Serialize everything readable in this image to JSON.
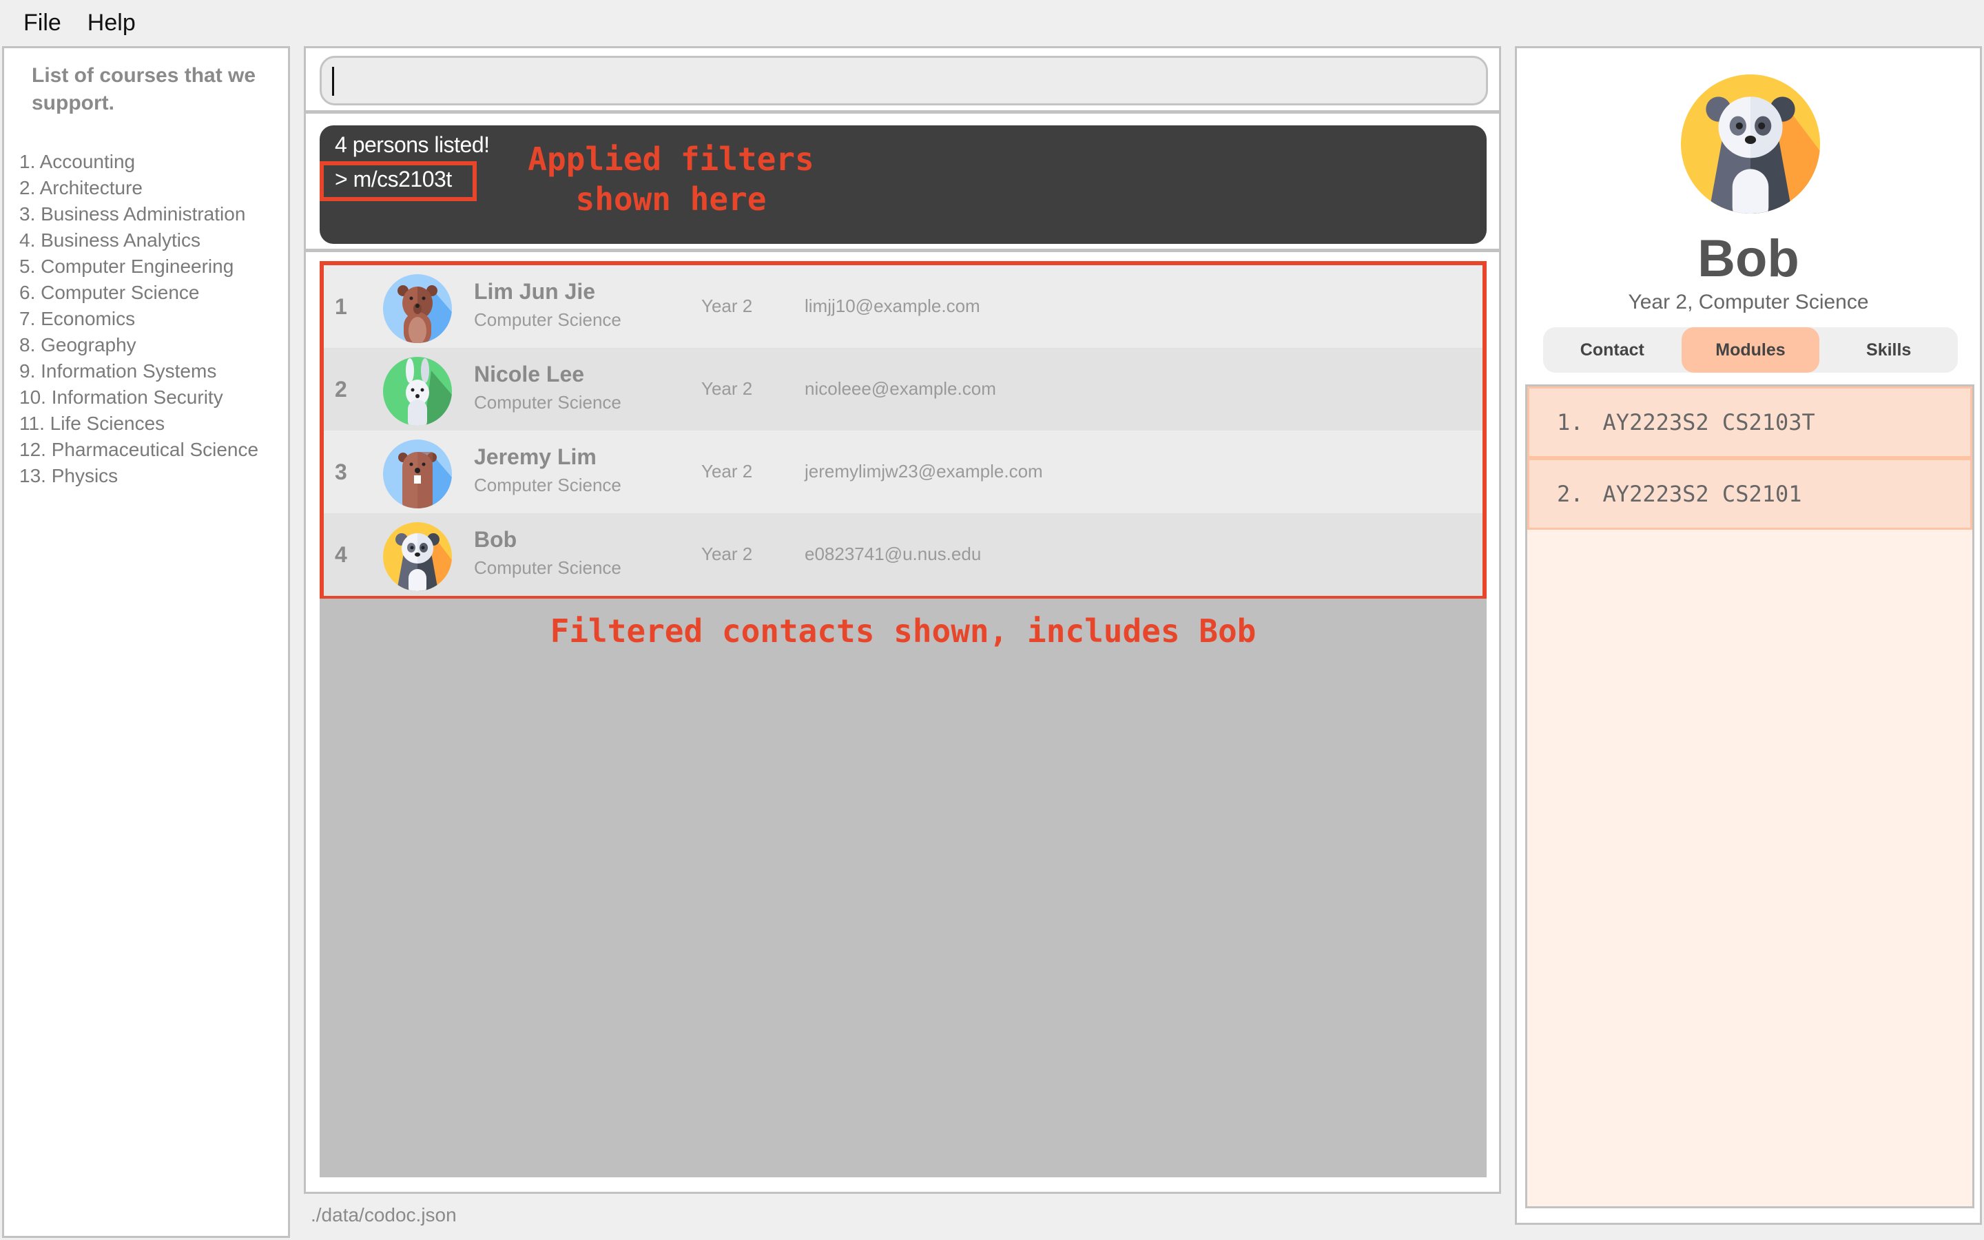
{
  "menu": {
    "items": [
      "File",
      "Help"
    ]
  },
  "sidebar": {
    "title": "List of courses that we support.",
    "courses": [
      "1. Accounting",
      "2. Architecture",
      "3. Business Administration",
      "4. Business Analytics",
      "5. Computer Engineering",
      "6. Computer Science",
      "7. Economics",
      "8. Geography",
      "9. Information Systems",
      "10. Information Security",
      "11. Life Sciences",
      "12. Pharmaceutical Science",
      "13. Physics"
    ]
  },
  "command": {
    "value": "",
    "placeholder": ""
  },
  "result": {
    "message": "4 persons listed!",
    "filter": "> m/cs2103t"
  },
  "annotations": {
    "filters": "Applied filters\nshown here",
    "filters_line1": "Applied filters",
    "filters_line2": "shown here",
    "list": "Filtered contacts shown, includes Bob",
    "color": "#e8462a"
  },
  "persons": [
    {
      "index": "1",
      "name": "Lim Jun Jie",
      "course": "Computer Science",
      "year": "Year 2",
      "email": "limjj10@example.com",
      "avatar": "bear-icon"
    },
    {
      "index": "2",
      "name": "Nicole Lee",
      "course": "Computer Science",
      "year": "Year 2",
      "email": "nicoleee@example.com",
      "avatar": "rabbit-icon"
    },
    {
      "index": "3",
      "name": "Jeremy Lim",
      "course": "Computer Science",
      "year": "Year 2",
      "email": "jeremylimjw23@example.com",
      "avatar": "beaver-icon"
    },
    {
      "index": "4",
      "name": "Bob",
      "course": "Computer Science",
      "year": "Year 2",
      "email": "e0823741@u.nus.edu",
      "avatar": "panda-icon"
    }
  ],
  "status": {
    "file_path": "./data/codoc.json"
  },
  "profile": {
    "name": "Bob",
    "subtitle": "Year 2, Computer Science",
    "avatar": "panda-icon",
    "tabs": [
      {
        "label": "Contact",
        "active": false
      },
      {
        "label": "Modules",
        "active": true
      },
      {
        "label": "Skills",
        "active": false
      }
    ],
    "modules": [
      {
        "num": "1.",
        "label": "AY2223S2 CS2103T"
      },
      {
        "num": "2.",
        "label": "AY2223S2 CS2101"
      }
    ],
    "accent_color": "#fdc3a2"
  }
}
